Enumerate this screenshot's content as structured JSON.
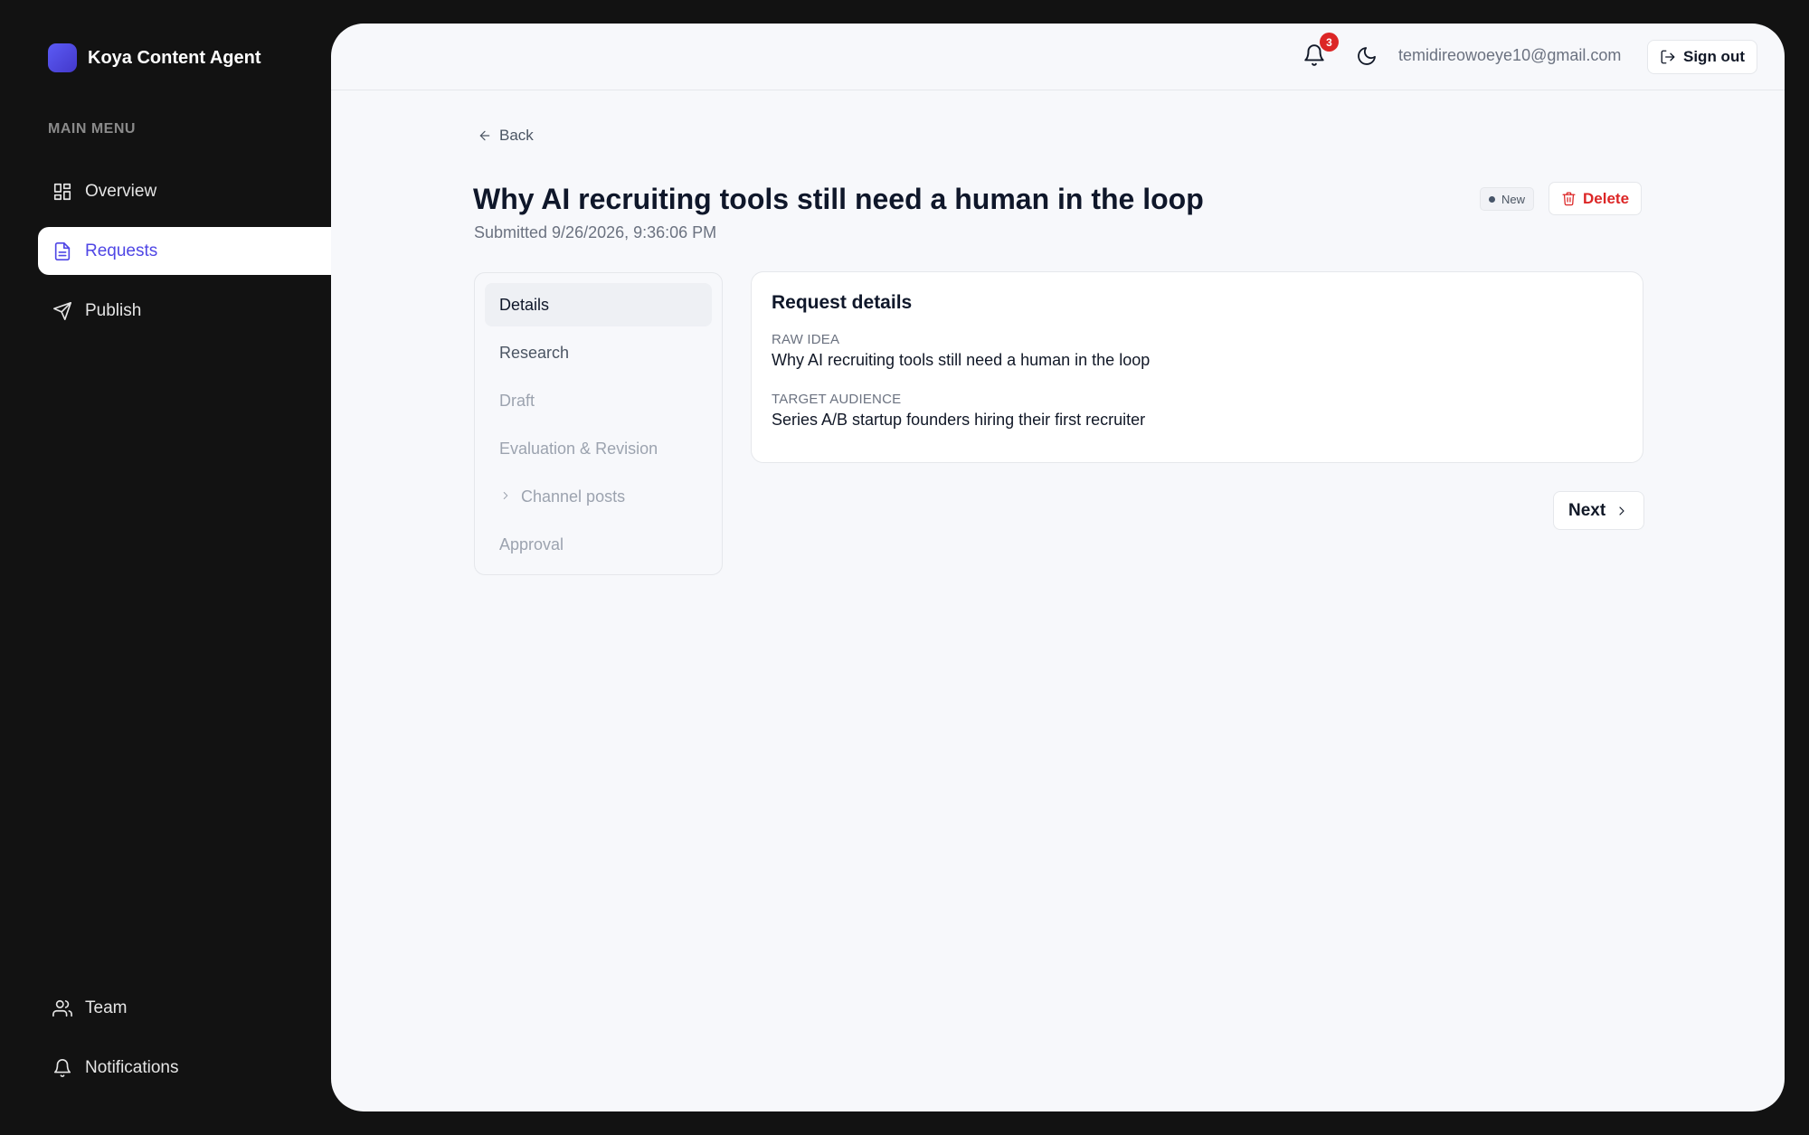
{
  "app": {
    "name": "Koya Content Agent"
  },
  "sidebar": {
    "menu_label": "MAIN MENU",
    "items": [
      {
        "label": "Overview",
        "icon": "grid-icon"
      },
      {
        "label": "Requests",
        "icon": "document-icon",
        "active": true
      },
      {
        "label": "Publish",
        "icon": "send-icon"
      }
    ],
    "bottom_items": [
      {
        "label": "Team",
        "icon": "users-icon"
      },
      {
        "label": "Notifications",
        "icon": "bell-icon"
      }
    ]
  },
  "header": {
    "notification_count": "3",
    "email": "temidireowoeye10@gmail.com",
    "sign_out_label": "Sign out"
  },
  "request": {
    "back_label": "Back",
    "title": "Why AI recruiting tools still need a human in the loop",
    "submitted": "Submitted 9/26/2026, 9:36:06 PM",
    "status": "New",
    "delete_label": "Delete"
  },
  "steps": [
    {
      "label": "Details",
      "state": "active"
    },
    {
      "label": "Research",
      "state": "enabled"
    },
    {
      "label": "Draft",
      "state": "disabled"
    },
    {
      "label": "Evaluation & Revision",
      "state": "disabled"
    },
    {
      "label": "Channel posts",
      "state": "disabled"
    },
    {
      "label": "Approval",
      "state": "disabled"
    }
  ],
  "details": {
    "title": "Request details",
    "raw_idea_label": "RAW IDEA",
    "raw_idea": "Why AI recruiting tools still need a human in the loop",
    "audience_label": "TARGET AUDIENCE",
    "audience": "Series A/B startup founders hiring their first recruiter"
  },
  "next_label": "Next",
  "colors": {
    "accent": "#4f46e5",
    "danger": "#dc2626",
    "sidebar_bg": "#121212"
  }
}
